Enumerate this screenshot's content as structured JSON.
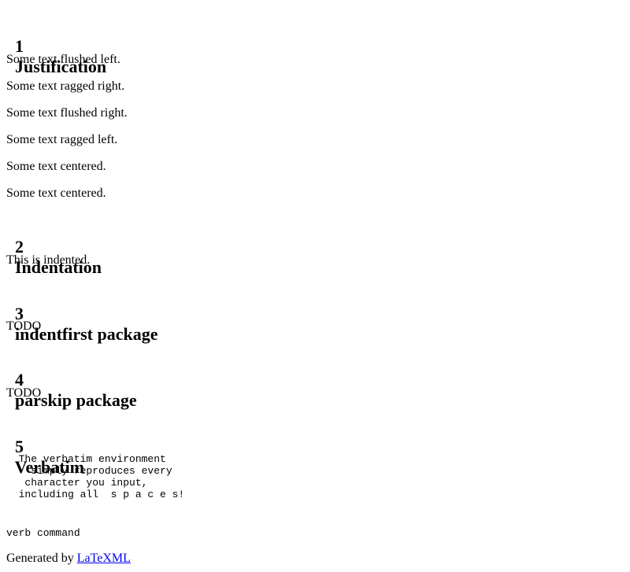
{
  "sections": [
    {
      "number": "1",
      "title": "Justification"
    },
    {
      "number": "2",
      "title": "Indentation"
    },
    {
      "number": "3",
      "title": "indentfirst package"
    },
    {
      "number": "4",
      "title": "parskip package"
    },
    {
      "number": "5",
      "title": "Verbatim"
    }
  ],
  "justification": {
    "lines": [
      "Some text flushed left.",
      "Some text ragged right.",
      "Some text flushed right.",
      "Some text ragged left.",
      "Some text centered.",
      "Some text centered."
    ]
  },
  "indentation": {
    "text": "This is indented."
  },
  "indentfirst": {
    "text": "TODO"
  },
  "parskip": {
    "text": "TODO"
  },
  "verbatim": {
    "lines": [
      "  The verbatim environment",
      "    simply reproduces every",
      "   character you input,",
      "  including all  s p a c e s!"
    ],
    "verb_command": "verb command"
  },
  "footer": {
    "prefix": "Generated by ",
    "link_label": "LaTeXML"
  }
}
